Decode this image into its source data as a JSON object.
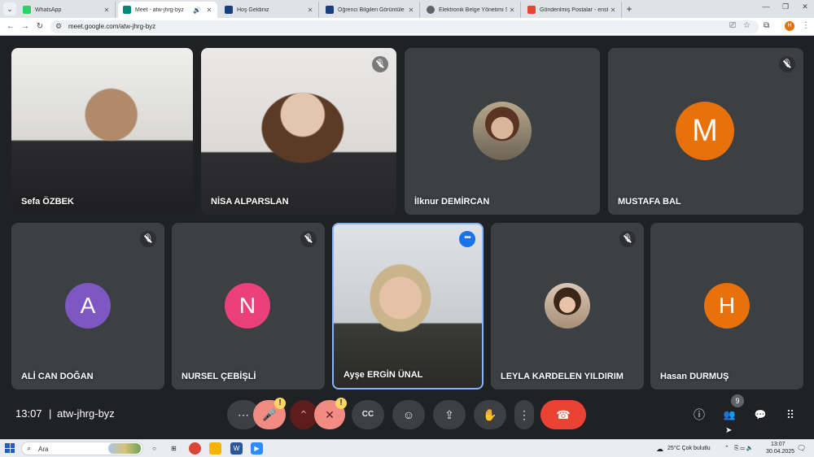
{
  "browser": {
    "tabs": [
      {
        "label": "WhatsApp",
        "icon": "whatsapp-icon",
        "color": "#25d366"
      },
      {
        "label": "Meet - atw-jhrg-byz",
        "icon": "meet-icon",
        "color": "#00897b",
        "active": true
      },
      {
        "label": "Hoş Geldiniz",
        "icon": "portal-icon",
        "color": "#1a3d7c"
      },
      {
        "label": "Öğrenci Bilgileri Görüntüle | Öğ",
        "icon": "portal-icon",
        "color": "#1a3d7c"
      },
      {
        "label": "Elektronik Belge Yönetimi Siste",
        "icon": "globe-icon",
        "color": "#5f6368"
      },
      {
        "label": "Gönderilmiş Postalar - enstitud",
        "icon": "gmail-icon",
        "color": "#ea4335"
      }
    ],
    "url": "meet.google.com/atw-jhrg-byz",
    "profile_initial": "H"
  },
  "participants": [
    {
      "name": "Sefa ÖZBEK",
      "type": "video",
      "muted": false
    },
    {
      "name": "NİSA ALPARSLAN",
      "type": "video",
      "muted": true
    },
    {
      "name": "İlknur DEMİRCAN",
      "type": "photo",
      "muted": false
    },
    {
      "name": "MUSTAFA BAL",
      "type": "initial",
      "initial": "M",
      "color": "#e8710a",
      "muted": true
    },
    {
      "name": "ALİ CAN DOĞAN",
      "type": "initial",
      "initial": "A",
      "color": "#7e57c2",
      "muted": true
    },
    {
      "name": "NURSEL ÇEBİŞLİ",
      "type": "initial",
      "initial": "N",
      "color": "#ec407a",
      "muted": true
    },
    {
      "name": "Ayşe ERGİN ÜNAL",
      "type": "video",
      "muted": false,
      "speaking": true
    },
    {
      "name": "LEYLA KARDELEN YILDIRIM",
      "type": "photo",
      "muted": true
    },
    {
      "name": "Hasan DURMUŞ",
      "type": "initial",
      "initial": "H",
      "color": "#e8710a",
      "muted": false
    }
  ],
  "meeting": {
    "time": "13:07",
    "separator": "|",
    "code": "atw-jhrg-byz",
    "participant_count": "9"
  },
  "controls": {
    "more": "⋯",
    "mic_icon": "🎤",
    "chevron_icon": "⌃",
    "cam_icon": "✕",
    "warning": "!",
    "captions": "CC",
    "emoji": "☺",
    "present": "⇪",
    "hand": "✋",
    "more_vert": "⋮",
    "leave": "☎"
  },
  "right_controls": {
    "info": "ⓘ",
    "people": "👥",
    "chat": "💬",
    "activities": "⠿"
  },
  "taskbar": {
    "search_placeholder": "Ara",
    "weather": "25°C  Çok bulutlu",
    "time": "13:07",
    "date": "30.04.2025"
  }
}
